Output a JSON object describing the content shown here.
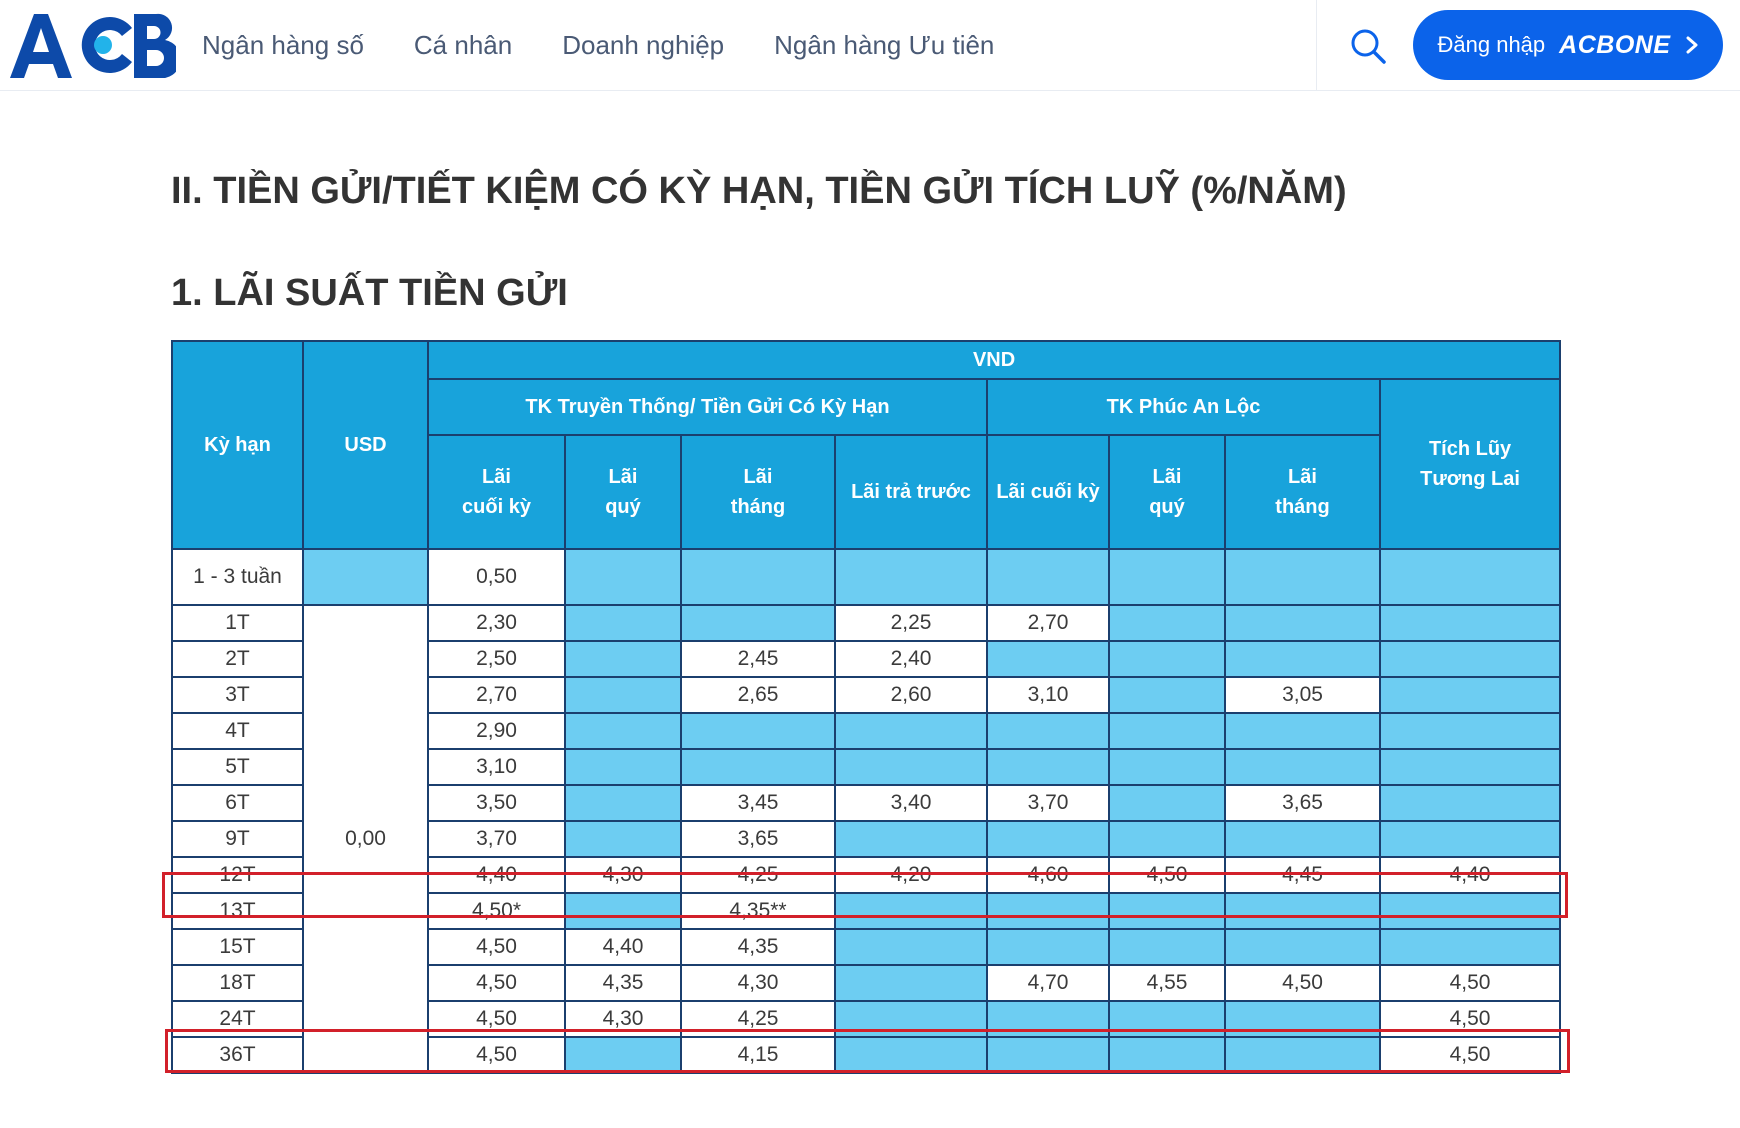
{
  "header": {
    "logo_text": "ACB",
    "nav": [
      "Ngân hàng số",
      "Cá nhân",
      "Doanh nghiệp",
      "Ngân hàng Ưu tiên"
    ],
    "search_icon": "search-icon",
    "login": {
      "label": "Đăng nhập",
      "brand": "ACBONE",
      "icon": "chevron-right-icon"
    }
  },
  "colors": {
    "brand": "#0b63ea",
    "header_cell": "#18a3db",
    "empty_cell": "#6dcdf2",
    "highlight": "#d2202a"
  },
  "page": {
    "title": "II. TIỀN GỬI/TIẾT KIỆM CÓ KỲ HẠN, TIỀN GỬI TÍCH LUỸ (%/NĂM)",
    "subtitle": "1. LÃI SUẤT TIỀN GỬI"
  },
  "table": {
    "head": {
      "term": "Kỳ hạn",
      "usd": "USD",
      "vnd": "VND",
      "group_traditional": "TK Truyền Thống/ Tiền Gửi Có Kỳ Hạn",
      "group_phuc_an_loc": "TK Phúc An Lộc",
      "future": "Tích Lũy Tương Lai",
      "t_end_a": "Lãi",
      "t_end_b": "cuối kỳ",
      "t_quarter_a": "Lãi",
      "t_quarter_b": "quý",
      "t_month_a": "Lãi",
      "t_month_b": "tháng",
      "t_prepaid": "Lãi trả trước",
      "p_end": "Lãi cuối kỳ",
      "p_quarter_a": "Lãi",
      "p_quarter_b": "quý",
      "p_month_a": "Lãi",
      "p_month_b": "tháng"
    },
    "usd_rate": "0,00",
    "rows": [
      {
        "term": "1 - 3 tuần",
        "t_end": "0,50",
        "t_quarter": "",
        "t_month": "",
        "t_prepaid": "",
        "p_end": "",
        "p_quarter": "",
        "p_month": "",
        "future": ""
      },
      {
        "term": "1T",
        "t_end": "2,30",
        "t_quarter": "",
        "t_month": "",
        "t_prepaid": "2,25",
        "p_end": "2,70",
        "p_quarter": "",
        "p_month": "",
        "future": ""
      },
      {
        "term": "2T",
        "t_end": "2,50",
        "t_quarter": "",
        "t_month": "2,45",
        "t_prepaid": "2,40",
        "p_end": "",
        "p_quarter": "",
        "p_month": "",
        "future": ""
      },
      {
        "term": "3T",
        "t_end": "2,70",
        "t_quarter": "",
        "t_month": "2,65",
        "t_prepaid": "2,60",
        "p_end": "3,10",
        "p_quarter": "",
        "p_month": "3,05",
        "future": ""
      },
      {
        "term": "4T",
        "t_end": "2,90",
        "t_quarter": "",
        "t_month": "",
        "t_prepaid": "",
        "p_end": "",
        "p_quarter": "",
        "p_month": "",
        "future": ""
      },
      {
        "term": "5T",
        "t_end": "3,10",
        "t_quarter": "",
        "t_month": "",
        "t_prepaid": "",
        "p_end": "",
        "p_quarter": "",
        "p_month": "",
        "future": ""
      },
      {
        "term": "6T",
        "t_end": "3,50",
        "t_quarter": "",
        "t_month": "3,45",
        "t_prepaid": "3,40",
        "p_end": "3,70",
        "p_quarter": "",
        "p_month": "3,65",
        "future": ""
      },
      {
        "term": "9T",
        "t_end": "3,70",
        "t_quarter": "",
        "t_month": "3,65",
        "t_prepaid": "",
        "p_end": "",
        "p_quarter": "",
        "p_month": "",
        "future": ""
      },
      {
        "term": "12T",
        "t_end": "4,40",
        "t_quarter": "4,30",
        "t_month": "4,25",
        "t_prepaid": "4,20",
        "p_end": "4,60",
        "p_quarter": "4,50",
        "p_month": "4,45",
        "future": "4,40"
      },
      {
        "term": "13T",
        "t_end": "4,50*",
        "t_quarter": "",
        "t_month": "4,35**",
        "t_prepaid": "",
        "p_end": "",
        "p_quarter": "",
        "p_month": "",
        "future": ""
      },
      {
        "term": "15T",
        "t_end": "4,50",
        "t_quarter": "4,40",
        "t_month": "4,35",
        "t_prepaid": "",
        "p_end": "",
        "p_quarter": "",
        "p_month": "",
        "future": ""
      },
      {
        "term": "18T",
        "t_end": "4,50",
        "t_quarter": "4,35",
        "t_month": "4,30",
        "t_prepaid": "",
        "p_end": "4,70",
        "p_quarter": "4,55",
        "p_month": "4,50",
        "future": "4,50"
      },
      {
        "term": "24T",
        "t_end": "4,50",
        "t_quarter": "4,30",
        "t_month": "4,25",
        "t_prepaid": "",
        "p_end": "",
        "p_quarter": "",
        "p_month": "",
        "future": "4,50"
      },
      {
        "term": "36T",
        "t_end": "4,50",
        "t_quarter": "",
        "t_month": "4,15",
        "t_prepaid": "",
        "p_end": "",
        "p_quarter": "",
        "p_month": "",
        "future": "4,50"
      }
    ]
  }
}
